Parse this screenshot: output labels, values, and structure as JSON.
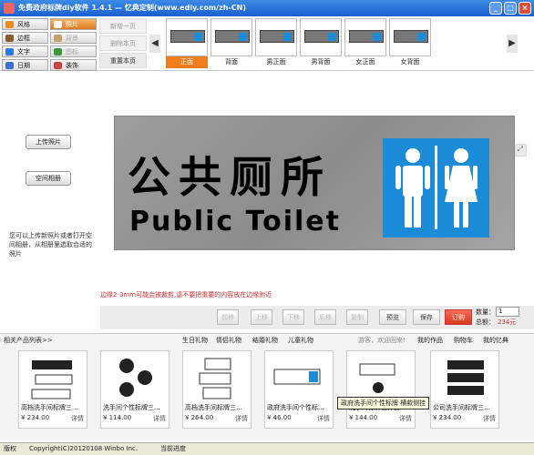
{
  "window": {
    "title": "免费政府标牌diy软件 1.4.1 — 忆典定制(www.ediy.com/zh-CN)"
  },
  "tools": [
    {
      "label": "风格",
      "color": "#f08a1a"
    },
    {
      "label": "照片",
      "color": "#f08a1a"
    },
    {
      "label": "边框",
      "color": "#8a5b2e"
    },
    {
      "label": "背景",
      "color": "#c9a26a"
    },
    {
      "label": "文字",
      "color": "#2b7bd8"
    },
    {
      "label": "图标",
      "color": "#3a9a3a"
    },
    {
      "label": "日期",
      "color": "#3a6fcf"
    },
    {
      "label": "装饰",
      "color": "#d04040"
    }
  ],
  "pages": [
    "新增一页",
    "删除本页",
    "重置本页"
  ],
  "thumbs": [
    "正面",
    "背面",
    "男正面",
    "男背面",
    "女正面",
    "女背面"
  ],
  "left": {
    "upload_label": "上传照片",
    "album_label": "空间相册",
    "hint": "您可以上传新照片或者打开空间相册，从相册里选取合适的照片"
  },
  "sign": {
    "cn": "公共厕所",
    "en": "Public Toilet"
  },
  "warning": "边缘2-3mm可能会被裁剪,请不要把重要的内容放在边缘附近",
  "actions": {
    "disabled": [
      "前移",
      "上移",
      "下移",
      "后移",
      "复制"
    ],
    "preview": "预览",
    "save": "保存",
    "order": "订购",
    "qty_label": "数量：",
    "qty_value": "1",
    "total_label": "总额：",
    "total_value": "234元"
  },
  "products": {
    "title": "相关产品列表>>",
    "cats": [
      "生日礼物",
      "情侣礼物",
      "结婚礼物",
      "儿童礼物"
    ],
    "user_tabs": [
      "游客，欢迎回来!",
      "我的作品",
      "购物车",
      "我的忆典"
    ],
    "items": [
      {
        "name": "高档洗手间标牌三...",
        "price": "¥ 234.00"
      },
      {
        "name": "洗手间个性标牌三...",
        "price": "¥ 114.00"
      },
      {
        "name": "高档洗手间标牌三...",
        "price": "¥ 264.00"
      },
      {
        "name": "政府洗手间个性标...",
        "price": "¥ 46.00"
      },
      {
        "name": "洗手间标牌三件套...",
        "price": "¥ 144.00"
      },
      {
        "name": "公司洗手间标牌三...",
        "price": "¥ 234.00"
      }
    ],
    "detail_label": "详情",
    "tooltip": "政府洗手间个性标牌 横款侧挂"
  },
  "status": {
    "copyright_label": "版权",
    "copyright": "Copyright(C)20120108 Winbo Inc.",
    "progress_label": "当前进度"
  }
}
